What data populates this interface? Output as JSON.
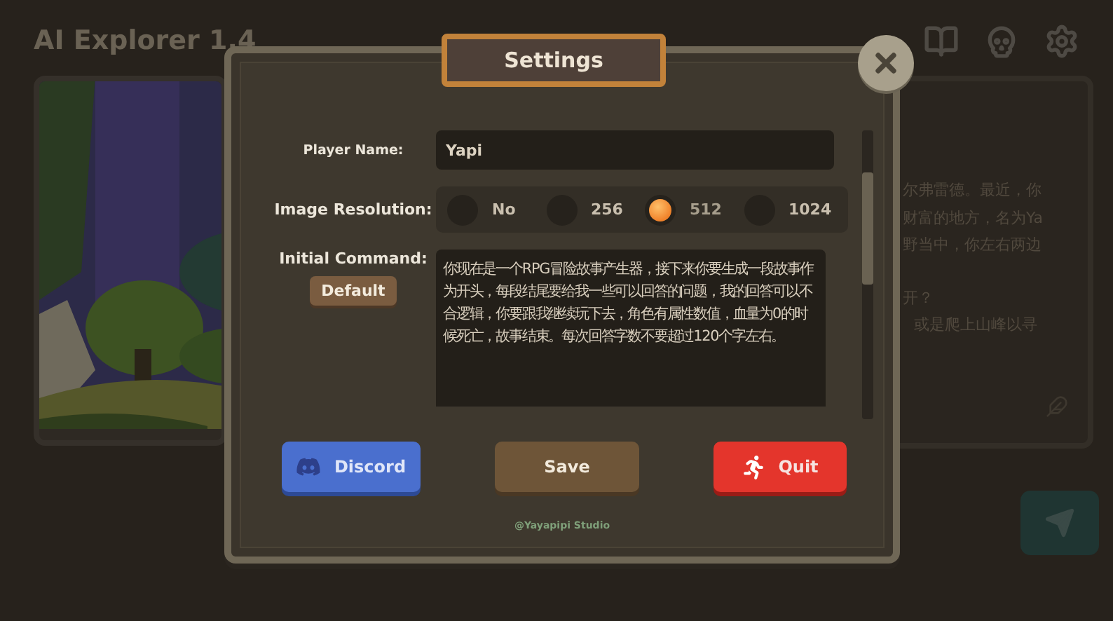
{
  "app": {
    "title": "AI Explorer 1.4"
  },
  "story": {
    "lines": [
      "尔弗雷德。最近，你",
      "财富的地方，名为Ya",
      "野当中，你左右两边",
      "开？",
      "或是爬上山峰以寻"
    ]
  },
  "settings": {
    "title": "Settings",
    "player_name": {
      "label": "Player Name:",
      "value": "Yapi"
    },
    "image_resolution": {
      "label": "Image Resolution:",
      "options": [
        {
          "label": "No",
          "selected": false
        },
        {
          "label": "256",
          "selected": false
        },
        {
          "label": "512",
          "selected": true
        },
        {
          "label": "1024",
          "selected": false
        }
      ]
    },
    "initial_command": {
      "label": "Initial Command:",
      "default_button": "Default",
      "value": "你现在是一个RPG冒险故事产生器，接下来你要生成一段故事作为开头，每段结尾要给我一些可以回答的问题，我的回答可以不合逻辑，你要跟我继续玩下去，角色有属性数值，血量为0的时候死亡，故事结束。每次回答字数不要超过120个字左右。"
    },
    "buttons": [
      {
        "kind": "discord",
        "label": "Discord"
      },
      {
        "kind": "save",
        "label": "Save"
      },
      {
        "kind": "quit",
        "label": "Quit"
      }
    ],
    "credit": "@Yayapipi Studio"
  }
}
